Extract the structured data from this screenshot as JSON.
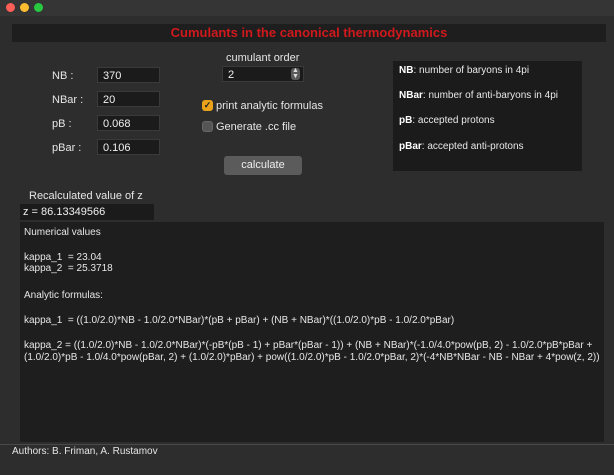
{
  "window": {
    "title": "Cumulants in the canonical thermodynamics"
  },
  "inputs": [
    {
      "label": "NB :",
      "value": "370"
    },
    {
      "label": "NBar :",
      "value": "20"
    },
    {
      "label": "pB :",
      "value": "0.068"
    },
    {
      "label": "pBar :",
      "value": "0.106"
    }
  ],
  "cumulant": {
    "label": "cumulant order",
    "value": "2"
  },
  "options": {
    "print_analytic": {
      "label": "print analytic formulas",
      "checked": true
    },
    "generate_cc": {
      "label": "Generate .cc file",
      "checked": false
    }
  },
  "calculate_label": "calculate",
  "info": [
    {
      "key": "NB",
      "text": ": number of baryons in 4pi"
    },
    {
      "key": "NBar",
      "text": ": number of anti-baryons in 4pi"
    },
    {
      "key": "pB",
      "text": ": accepted protons"
    },
    {
      "key": "pBar",
      "text": ": accepted anti-protons"
    }
  ],
  "z": {
    "label": "Recalculated value of z",
    "value": "z = 86.13349566"
  },
  "output": {
    "numerical_heading": "Numerical values",
    "kappa_1": "kappa_1  = 23.04",
    "kappa_2": "kappa_2  = 25.3718",
    "analytic_heading": "Analytic formulas:",
    "kappa_1_formula": "kappa_1  = ((1.0/2.0)*NB - 1.0/2.0*NBar)*(pB + pBar) + (NB + NBar)*((1.0/2.0)*pB - 1.0/2.0*pBar)",
    "kappa_2_formula": "kappa_2  = ((1.0/2.0)*NB - 1.0/2.0*NBar)*(-pB*(pB - 1) + pBar*(pBar - 1)) + (NB + NBar)*(-1.0/4.0*pow(pB, 2) - 1.0/2.0*pB*pBar + (1.0/2.0)*pB - 1.0/4.0*pow(pBar, 2) + (1.0/2.0)*pBar) + pow((1.0/2.0)*pB - 1.0/2.0*pBar, 2)*(-4*NB*NBar - NB - NBar + 4*pow(z, 2))"
  },
  "authors": "Authors: B. Friman, A. Rustamov",
  "icons": {
    "stepper": "stepper-arrows-icon",
    "checkmark": "checkmark-icon"
  },
  "colors": {
    "title_red": "#d0191c",
    "checkbox_orange": "#e9a21a"
  }
}
